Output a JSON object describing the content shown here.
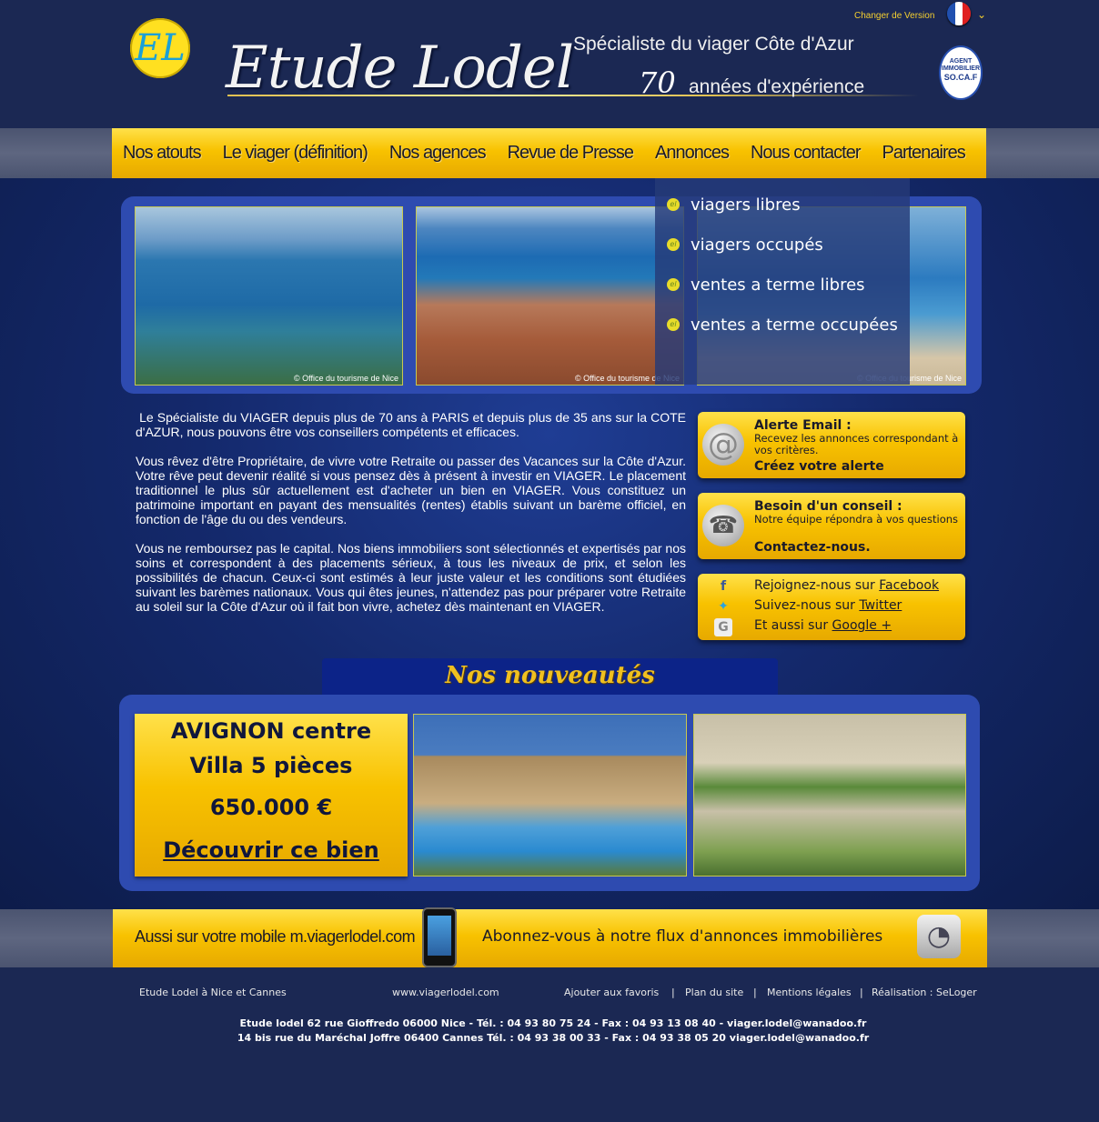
{
  "header": {
    "logo_letters": "EL",
    "brand": "Etude Lodel",
    "tagline_specialist": "Spécialiste du viager Côte d'Azur",
    "tagline_years": "70",
    "tagline_experience": "années d'expérience",
    "change_version": "Changer de Version",
    "badge_top": "AGENT IMMOBILIER",
    "badge_bottom": "SO.CA.F"
  },
  "nav": {
    "items": [
      {
        "label": "Nos atouts"
      },
      {
        "label": "Le viager (définition)"
      },
      {
        "label": "Nos agences"
      },
      {
        "label": "Revue de Presse"
      },
      {
        "label": "Annonces"
      },
      {
        "label": "Nous contacter"
      },
      {
        "label": "Partenaires"
      }
    ],
    "dropdown": [
      {
        "label": "viagers libres"
      },
      {
        "label": "viagers occupés"
      },
      {
        "label": "ventes a terme libres"
      },
      {
        "label": "ventes a terme occupées"
      }
    ]
  },
  "banner": {
    "credit": "© Office du tourisme de Nice"
  },
  "intro": {
    "p1": " Le Spécialiste du VIAGER depuis plus de 70 ans à PARIS et depuis plus de 35 ans sur la COTE d'AZUR, nous pouvons être vos conseillers compétents et efficaces.",
    "p2": "Vous rêvez d'être Propriétaire, de vivre votre Retraite ou passer des Vacances sur la Côte d'Azur. Votre rêve peut devenir réalité si vous pensez dès à présent à investir en VIAGER. Le placement traditionnel le plus sûr actuellement est d'acheter un bien en VIAGER. Vous constituez un patrimoine important en payant des mensualités (rentes) établis suivant un barème officiel, en fonction de l'âge du ou des vendeurs.",
    "p3": "Vous ne remboursez pas le capital. Nos biens immobiliers sont sélectionnés et expertisés par nos soins et correspondent à des placements sérieux, à tous les niveaux de prix, et selon les possibilités de chacun. Ceux-ci sont estimés à leur juste valeur et les conditions sont étudiées suivant les barèmes nationaux. Vous qui êtes jeunes, n'attendez pas pour préparer votre Retraite au soleil sur la Côte d'Azur où il fait bon vivre, achetez dès maintenant en VIAGER."
  },
  "sidebar": {
    "alert": {
      "title": "Alerte Email :",
      "text": "Recevez les annonces correspondant à vos critères.",
      "cta": "Créez votre alerte"
    },
    "advice": {
      "title": "Besoin d'un conseil :",
      "text": "Notre équipe répondra à vos questions",
      "cta": "Contactez-nous."
    },
    "social": [
      {
        "prefix": "Rejoignez-nous sur",
        "link": "Facebook"
      },
      {
        "prefix": "Suivez-nous sur",
        "link": "Twitter"
      },
      {
        "prefix": "Et aussi sur",
        "link": "Google +"
      }
    ]
  },
  "nouveautes": {
    "title": "Nos nouveautés",
    "promo_city": "AVIGNON centre",
    "promo_type": "Villa 5 pièces",
    "promo_price": "650.000 €",
    "promo_cta": "Découvrir ce bien"
  },
  "bottom_bar": {
    "mobile": "Aussi sur votre mobile m.viagerlodel.com",
    "rss": "Abonnez-vous à notre flux d'annonces immobilières"
  },
  "footer": {
    "left": "Etude Lodel à Nice et Cannes",
    "site": "www.viagerlodel.com",
    "links": [
      "Ajouter aux favoris",
      "Plan du site",
      "Mentions légales",
      "Réalisation : SeLoger"
    ],
    "separator": "|",
    "address1": "Etude lodel 62 rue Gioffredo 06000 Nice - Tél. : 04 93 80 75 24 - Fax : 04 93 13 08 40 - viager.lodel@wanadoo.fr",
    "address2": "14 bis rue du Maréchal Joffre 06400 Cannes Tél. : 04 93 38 00 33 - Fax : 04 93 38 05 20 viager.lodel@wanadoo.fr"
  },
  "colors": {
    "background": "#1b2853",
    "gold": "#f8c200",
    "panel": "#2e4bb0",
    "nouveautes_tab": "#0c2388"
  },
  "icons": [
    "flag-fr-icon",
    "at-icon",
    "phone-icon",
    "facebook-icon",
    "twitter-icon",
    "google-icon",
    "smartphone-icon",
    "rss-icon"
  ]
}
